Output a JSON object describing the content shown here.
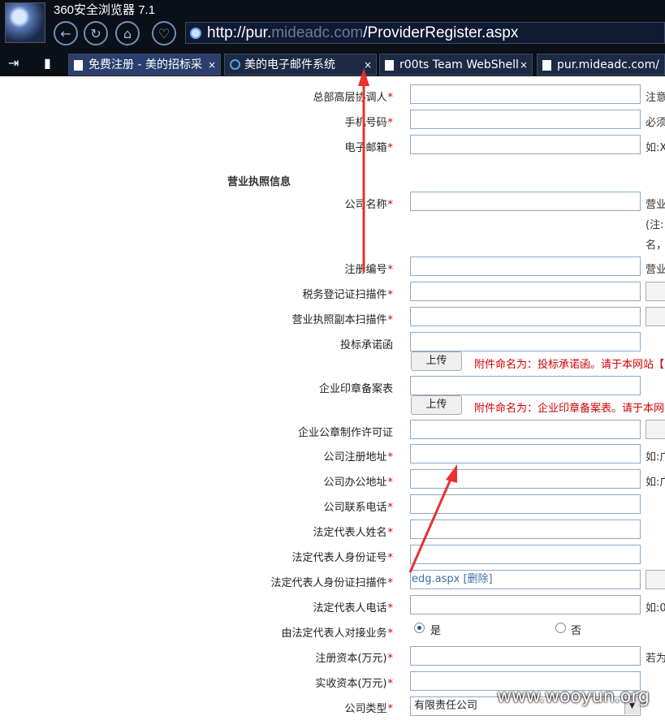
{
  "browser": {
    "title": "360安全浏览器 7.1",
    "url_prefix": "http://pur.",
    "url_mid": "mideadc.com",
    "url_suffix": "/ProviderRegister.aspx",
    "tabs": [
      {
        "label": "免费注册 - 美的招标采"
      },
      {
        "label": "美的电子邮件系统"
      },
      {
        "label": "r00ts Team WebShell"
      },
      {
        "label": "pur.mideadc.com/"
      }
    ],
    "close_glyph": "×"
  },
  "form": {
    "req_mark": "*",
    "rows": [
      {
        "label": "总部高层协调人",
        "hint": "注意"
      },
      {
        "label": "手机号码",
        "hint": "必须"
      },
      {
        "label": "电子邮箱",
        "hint": "如:X"
      },
      {
        "label": "公司名称",
        "hint": "营业"
      },
      {
        "label": "注册编号",
        "hint": "营业"
      },
      {
        "label": "税务登记证扫描件"
      },
      {
        "label": "营业执照副本扫描件"
      },
      {
        "label": "投标承诺函"
      },
      {
        "label": "企业印章备案表"
      },
      {
        "label": "企业公章制作许可证"
      },
      {
        "label": "公司注册地址",
        "hint": "如:广"
      },
      {
        "label": "公司办公地址",
        "hint": "如:广"
      },
      {
        "label": "公司联系电话"
      },
      {
        "label": "法定代表人姓名"
      },
      {
        "label": "法定代表人身份证号"
      },
      {
        "label": "法定代表人身份证扫描件"
      },
      {
        "label": "法定代表人电话",
        "hint": "如:0"
      },
      {
        "label": "由法定代表人对接业务"
      },
      {
        "label": "注册资本(万元)",
        "hint": "若为"
      },
      {
        "label": "实收资本(万元)"
      },
      {
        "label": "公司类型"
      }
    ],
    "section_title": "营业执照信息",
    "company_note_1": "(注:以",
    "company_note_2": "名，",
    "upload_label": "上传",
    "upload_note_1": "附件命名为：投标承诺函。请于本网站【",
    "upload_note_2": "附件命名为：企业印章备案表。请于本网",
    "file_name": "edg.aspx",
    "file_delete": "[删除]",
    "radio_yes": "是",
    "radio_no": "否",
    "company_type": "有限责任公司"
  },
  "watermark": "www.wooyun.org"
}
